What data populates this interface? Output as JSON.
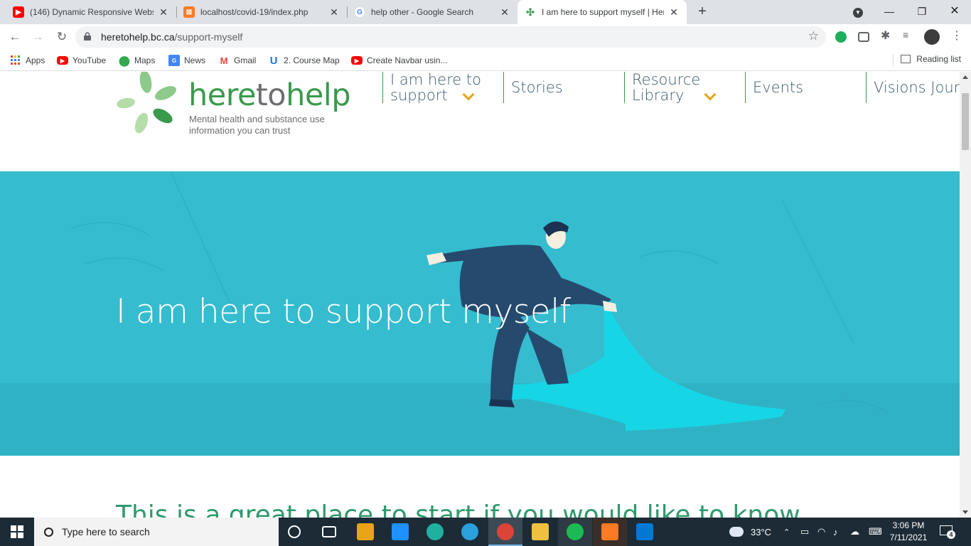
{
  "browser": {
    "tabs": [
      {
        "title": "(146) Dynamic Responsive Websi",
        "icon": "youtube-icon",
        "active": false
      },
      {
        "title": "localhost/covid-19/index.php",
        "icon": "xampp-icon",
        "active": false
      },
      {
        "title": "help other - Google Search",
        "icon": "google-icon",
        "active": false
      },
      {
        "title": "I am here to support myself | Her",
        "icon": "heretohelp-icon",
        "active": true
      }
    ],
    "url_domain": "heretohelp.bc.ca",
    "url_path": "/support-myself",
    "bookmarks": [
      {
        "label": "Apps",
        "icon": "apps-grid-icon"
      },
      {
        "label": "YouTube",
        "icon": "youtube-icon"
      },
      {
        "label": "Maps",
        "icon": "maps-pin-icon"
      },
      {
        "label": "News",
        "icon": "news-icon"
      },
      {
        "label": "Gmail",
        "icon": "gmail-icon"
      },
      {
        "label": "2. Course Map",
        "icon": "course-map-icon"
      },
      {
        "label": "Create Navbar usin...",
        "icon": "youtube-icon"
      }
    ],
    "reading_list": "Reading list"
  },
  "site": {
    "brand_part1": "hereto",
    "brand_part2": "help",
    "brand_green": "here",
    "brand_gray": "to",
    "brand_green2": "help",
    "tagline_line1": "Mental health and substance use",
    "tagline_line2": "information you can trust",
    "nav": [
      {
        "line1": "I am here to",
        "line2": "support",
        "has_dropdown": true
      },
      {
        "line1": "Stories",
        "line2": "",
        "has_dropdown": false
      },
      {
        "line1": "Resource",
        "line2": "Library",
        "has_dropdown": true
      },
      {
        "line1": "Events",
        "line2": "",
        "has_dropdown": false
      },
      {
        "line1": "Visions Jour",
        "line2": "",
        "has_dropdown": false
      }
    ],
    "hero_title": "I am here to support myself",
    "intro_text": "This is a great place to start if you would like to know",
    "colors": {
      "green": "#3a9a4b",
      "hero_bg": "#35bccf",
      "accent": "#e8a317"
    }
  },
  "taskbar": {
    "search_placeholder": "Type here to search",
    "weather": "33°C",
    "time": "3:06 PM",
    "date": "7/11/2021",
    "notifications": "4"
  }
}
